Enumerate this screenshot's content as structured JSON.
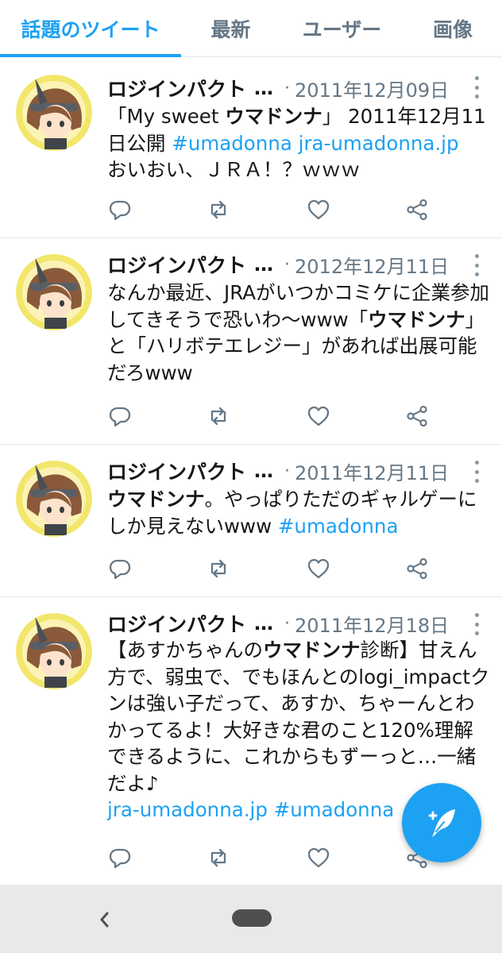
{
  "tabs": [
    {
      "label": "話題のツイート",
      "active": true
    },
    {
      "label": "最新",
      "active": false
    },
    {
      "label": "ユーザー",
      "active": false
    },
    {
      "label": "画像",
      "active": false
    }
  ],
  "colors": {
    "accent": "#1da1f2",
    "secondary_text": "#657786",
    "divider": "#e1e8ed"
  },
  "tweets": [
    {
      "name": "ロジインパクト",
      "ellipsis": "…",
      "separator": "·",
      "date": "2011年12月09日",
      "segments": [
        {
          "text": "「My sweet "
        },
        {
          "text": "ウマドンナ",
          "bold": true
        },
        {
          "text": "」 2011年12月11日公開 "
        },
        {
          "text": "#umadonna",
          "link": true
        },
        {
          "text": " "
        },
        {
          "text": "jra-umadonna.jp",
          "link": true
        },
        {
          "text": "\nおいおい、ＪＲＡ！？ｗｗｗ"
        }
      ]
    },
    {
      "name": "ロジインパクト",
      "ellipsis": "…",
      "separator": "·",
      "date": "2012年12月11日",
      "segments": [
        {
          "text": "なんか最近、JRAがいつかコミケに企業参加してきそうで恐いわ〜www「"
        },
        {
          "text": "ウマドンナ",
          "bold": true
        },
        {
          "text": "」と「ハリボテエレジー」があれば出展可能だろwww"
        }
      ]
    },
    {
      "name": "ロジインパクト",
      "ellipsis": "…",
      "separator": "·",
      "date": "2011年12月11日",
      "segments": [
        {
          "text": "ウマドンナ",
          "bold": true
        },
        {
          "text": "。やっぱりただのギャルゲーにしか見えないwww "
        },
        {
          "text": "#umadonna",
          "link": true
        }
      ]
    },
    {
      "name": "ロジインパクト",
      "ellipsis": "…",
      "separator": "·",
      "date": "2011年12月18日",
      "segments": [
        {
          "text": "【あすかちゃんの"
        },
        {
          "text": "ウマドンナ",
          "bold": true
        },
        {
          "text": "診断】甘えん方で、弱虫で、でもほんとのlogi_impactクンは強い子だって、あすか、ちゃーんとわかってるよ！大好きな君のこと120%理解できるように、これからもずーっと…一緒だよ♪\n"
        },
        {
          "text": "jra-umadonna.jp",
          "link": true
        },
        {
          "text": " "
        },
        {
          "text": "#umadonna",
          "link": true
        }
      ]
    }
  ],
  "icons": {
    "reply": "reply-icon",
    "retweet": "retweet-icon",
    "like": "heart-icon",
    "share": "share-icon",
    "compose": "compose-tweet-icon",
    "back": "back-icon",
    "home": "home-pill-icon"
  }
}
